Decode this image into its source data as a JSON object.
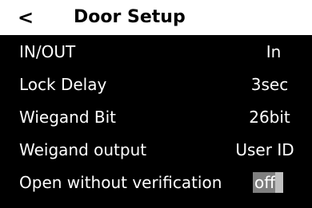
{
  "header": {
    "back_icon": "<",
    "title": "Door Setup"
  },
  "settings": [
    {
      "label": "IN/OUT",
      "value": "In"
    },
    {
      "label": "Lock Delay",
      "value": "3sec"
    },
    {
      "label": "Wiegand Bit",
      "value": "26bit"
    },
    {
      "label": "Weigand output",
      "value": "User ID"
    },
    {
      "label": "Open without verification",
      "value": "off"
    }
  ],
  "colors": {
    "background": "#000000",
    "header_background": "#ffffff",
    "text": "#ffffff",
    "toggle_off": "#7f7f7f"
  }
}
